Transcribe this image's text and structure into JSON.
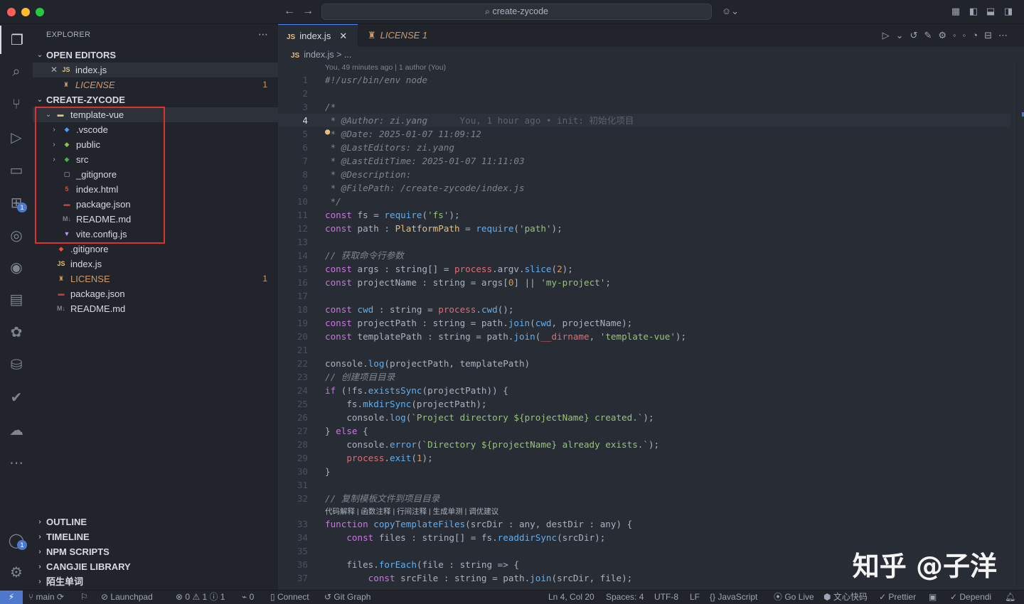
{
  "window": {
    "search_text": "create-zycode"
  },
  "sidebar": {
    "title": "EXPLORER",
    "open_editors_label": "OPEN EDITORS",
    "open_editors": [
      {
        "name": "index.js",
        "icon": "js-icon"
      },
      {
        "name": "LICENSE",
        "icon": "license-icon",
        "count": "1"
      }
    ],
    "project_label": "CREATE-ZYCODE",
    "tree": [
      {
        "name": "template-vue",
        "kind": "folder-open"
      },
      {
        "name": ".vscode",
        "kind": "folder"
      },
      {
        "name": "public",
        "kind": "folder"
      },
      {
        "name": "src",
        "kind": "folder"
      },
      {
        "name": "_gitignore",
        "kind": "file"
      },
      {
        "name": "index.html",
        "kind": "file"
      },
      {
        "name": "package.json",
        "kind": "file"
      },
      {
        "name": "README.md",
        "kind": "file"
      },
      {
        "name": "vite.config.js",
        "kind": "file"
      },
      {
        "name": ".gitignore",
        "kind": "file"
      },
      {
        "name": "index.js",
        "kind": "file"
      },
      {
        "name": "LICENSE",
        "kind": "file",
        "count": "1"
      },
      {
        "name": "package.json",
        "kind": "file"
      },
      {
        "name": "README.md",
        "kind": "file"
      }
    ],
    "bottom_sections": [
      "OUTLINE",
      "TIMELINE",
      "NPM SCRIPTS",
      "CANGJIE LIBRARY",
      "陌生单词"
    ]
  },
  "tabs": [
    {
      "label": "index.js",
      "prefix": "JS"
    },
    {
      "label": "LICENSE 1"
    }
  ],
  "breadcrumb": {
    "prefix": "JS",
    "file": "index.js",
    "rest": "> ..."
  },
  "codelens_author": "You, 49 minutes ago | 1 author (You)",
  "codelens_actions": "代码解释 | 函数注释 | 行间注释 | 生成单测 | 调优建议",
  "blame_inline": "You, 1 hour ago • init: 初始化项目",
  "line_numbers": [
    "1",
    "2",
    "3",
    "4",
    "5",
    "6",
    "7",
    "8",
    "9",
    "10",
    "11",
    "12",
    "13",
    "14",
    "15",
    "16",
    "17",
    "18",
    "19",
    "20",
    "21",
    "22",
    "23",
    "24",
    "25",
    "26",
    "27",
    "28",
    "29",
    "30",
    "31",
    "32",
    "33",
    "34",
    "35",
    "36",
    "37"
  ],
  "code_lines": [
    "#!/usr/bin/env node",
    "",
    "/*",
    " * @Author: zi.yang",
    " * @Date: 2025-01-07 11:09:12",
    " * @LastEditors: zi.yang",
    " * @LastEditTime: 2025-01-07 11:11:03",
    " * @Description:",
    " * @FilePath: /create-zycode/index.js",
    " */",
    "const fs = require('fs');",
    "const path : PlatformPath = require('path');",
    "",
    "// 获取命令行参数",
    "const args : string[] = process.argv.slice(2);",
    "const projectName : string = args[0] || 'my-project';",
    "",
    "const cwd : string = process.cwd();",
    "const projectPath : string = path.join(cwd, projectName);",
    "const templatePath : string = path.join(__dirname, 'template-vue');",
    "",
    "console.log(projectPath, templatePath)",
    "// 创建项目目录",
    "if (!fs.existsSync(projectPath)) {",
    "    fs.mkdirSync(projectPath);",
    "    console.log(`Project directory ${projectName} created.`);",
    "} else {",
    "    console.error(`Directory ${projectName} already exists.`);",
    "    process.exit(1);",
    "}",
    "",
    "// 复制模板文件到项目目录",
    "function copyTemplateFiles(srcDir : any, destDir : any) {",
    "    const files : string[] = fs.readdirSync(srcDir);",
    "",
    "    files.forEach(file : string => {",
    "        const srcFile : string = path.join(srcDir, file);"
  ],
  "watermark": "知乎 @子洋",
  "status": {
    "branch": "main",
    "launchpad": "Launchpad",
    "problems": "⊗ 0 ⚠ 1 ⓘ 1",
    "ports": "0",
    "connect": "Connect",
    "git_graph": "Git Graph",
    "position": "Ln 4, Col 20",
    "spaces": "Spaces: 4",
    "encoding": "UTF-8",
    "eol": "LF",
    "language": "JavaScript",
    "golive": "Go Live",
    "wenxin": "文心快码",
    "prettier": "Prettier",
    "dependi": "Dependi"
  },
  "colors": {
    "accent": "#528bff",
    "badge": "#4d78cc",
    "highlight_box": "#e03030"
  }
}
